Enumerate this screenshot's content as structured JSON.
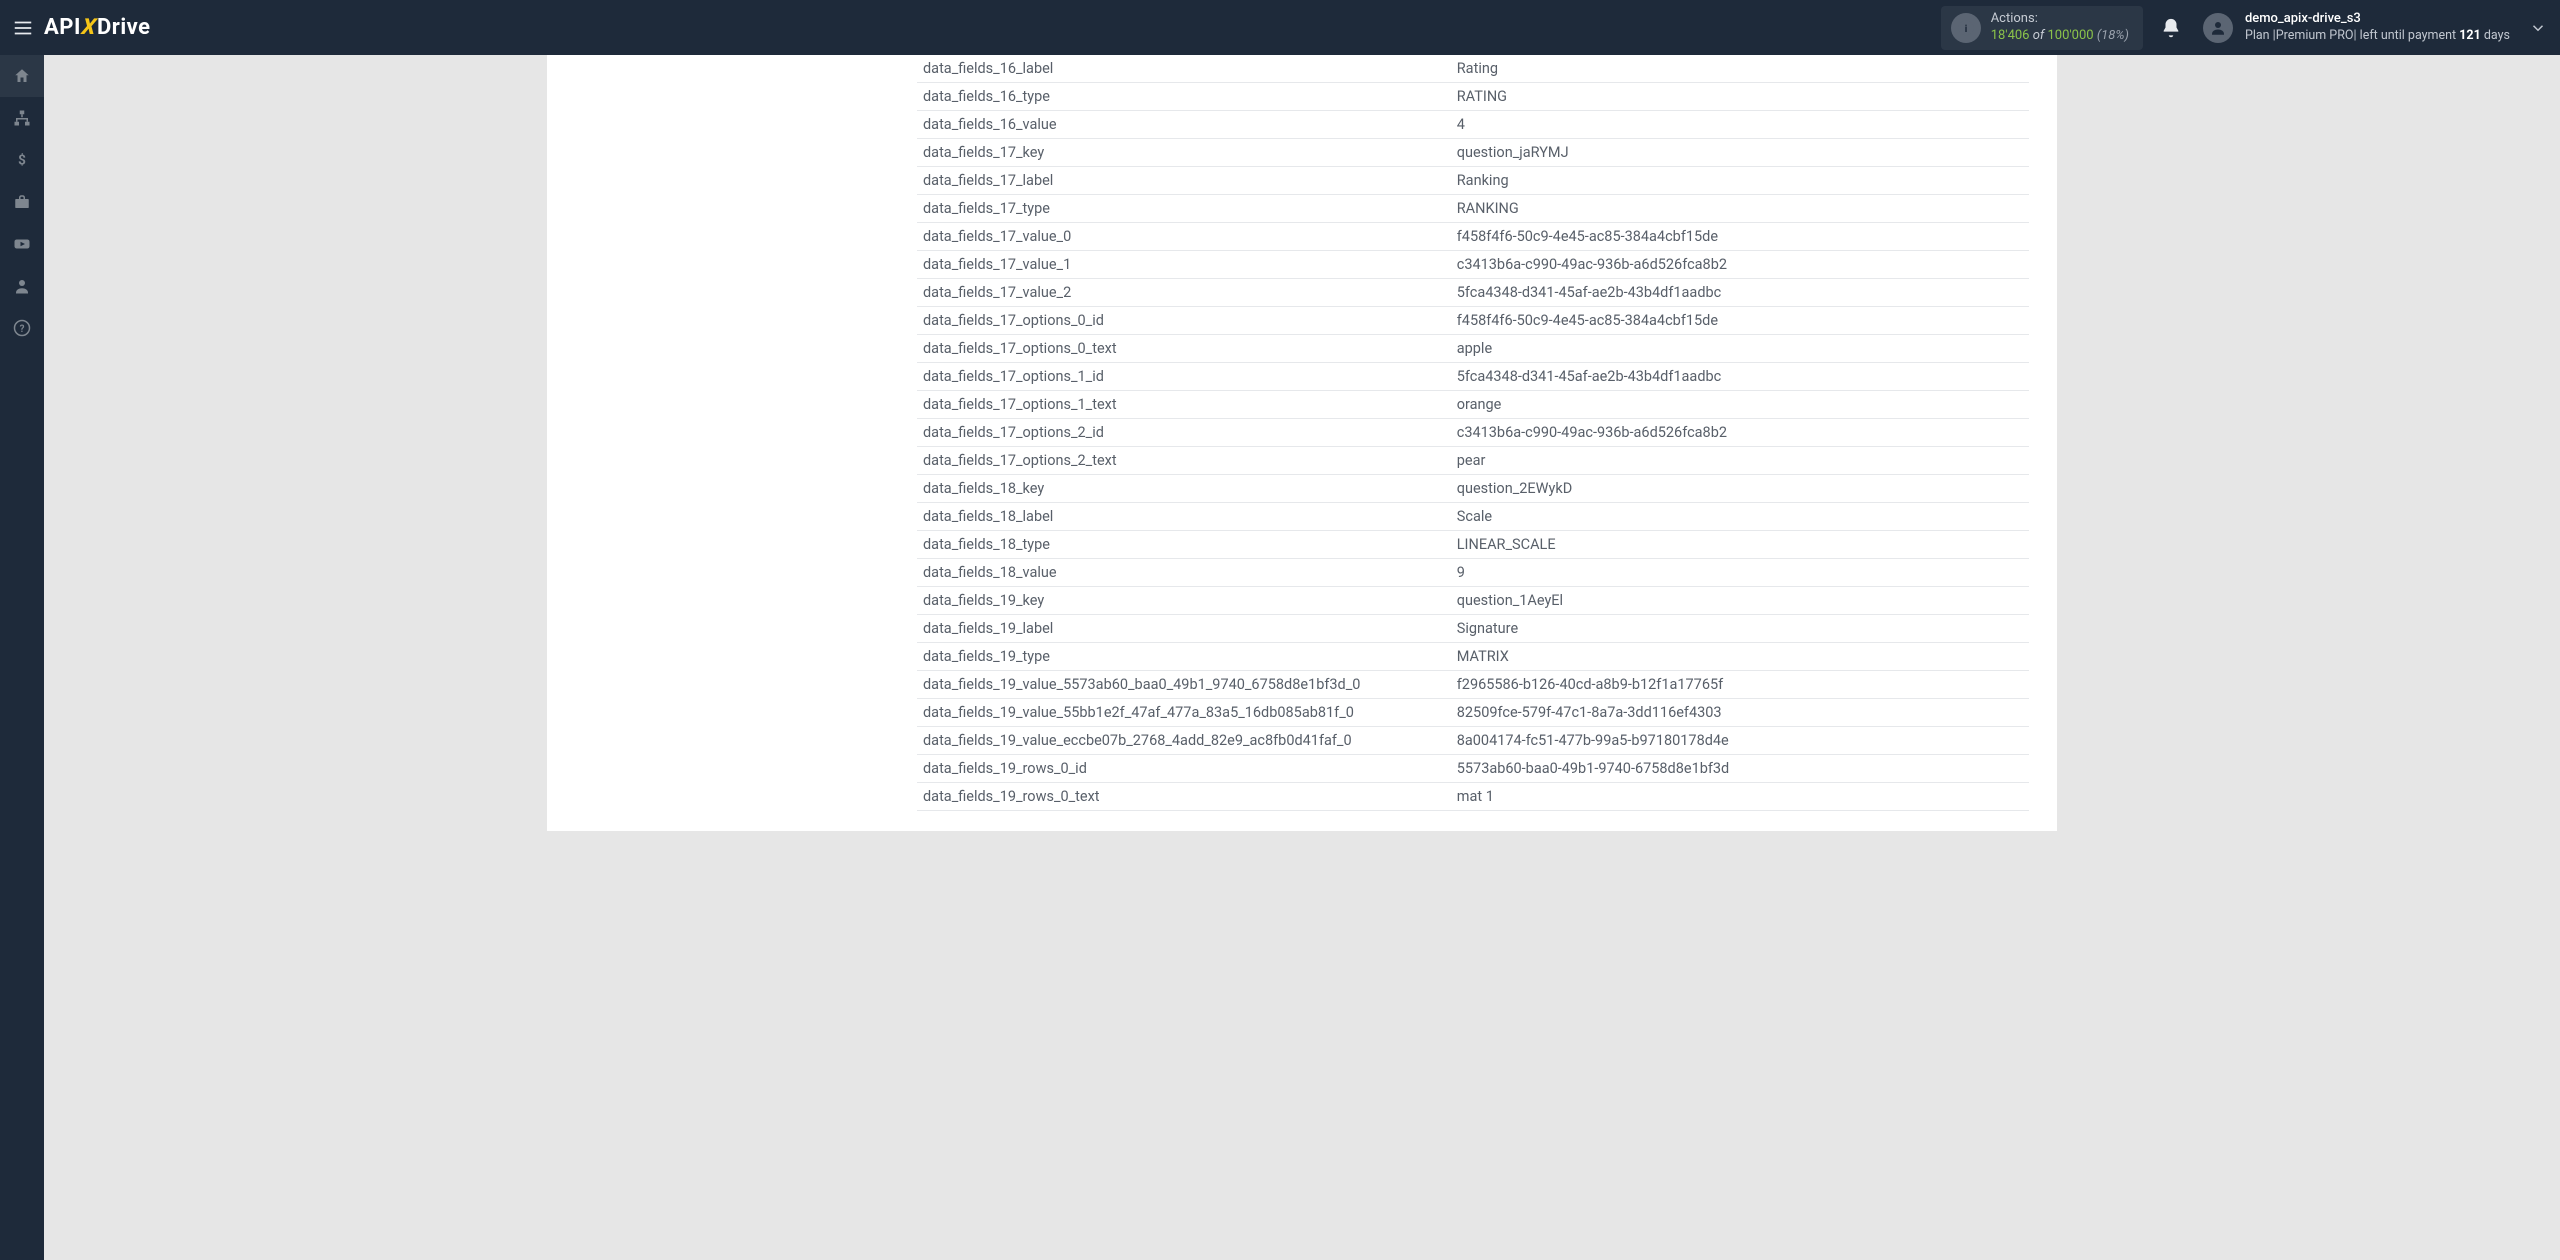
{
  "header": {
    "actions_label": "Actions:",
    "actions_current": "18'406",
    "actions_of": " of ",
    "actions_max": "100'000",
    "actions_pct": "(18%)",
    "username": "demo_apix-drive_s3",
    "plan_prefix": "Plan |",
    "plan_name": "Premium PRO",
    "plan_mid": "| left until payment ",
    "plan_days_num": "121",
    "plan_days_suffix": " days"
  },
  "logo": {
    "pre": "API",
    "x": "X",
    "post": "Drive"
  },
  "rows": [
    {
      "k": "data_fields_16_label",
      "v": "Rating"
    },
    {
      "k": "data_fields_16_type",
      "v": "RATING"
    },
    {
      "k": "data_fields_16_value",
      "v": "4"
    },
    {
      "k": "data_fields_17_key",
      "v": "question_jaRYMJ"
    },
    {
      "k": "data_fields_17_label",
      "v": "Ranking"
    },
    {
      "k": "data_fields_17_type",
      "v": "RANKING"
    },
    {
      "k": "data_fields_17_value_0",
      "v": "f458f4f6-50c9-4e45-ac85-384a4cbf15de"
    },
    {
      "k": "data_fields_17_value_1",
      "v": "c3413b6a-c990-49ac-936b-a6d526fca8b2"
    },
    {
      "k": "data_fields_17_value_2",
      "v": "5fca4348-d341-45af-ae2b-43b4df1aadbc"
    },
    {
      "k": "data_fields_17_options_0_id",
      "v": "f458f4f6-50c9-4e45-ac85-384a4cbf15de"
    },
    {
      "k": "data_fields_17_options_0_text",
      "v": "apple"
    },
    {
      "k": "data_fields_17_options_1_id",
      "v": "5fca4348-d341-45af-ae2b-43b4df1aadbc"
    },
    {
      "k": "data_fields_17_options_1_text",
      "v": "orange"
    },
    {
      "k": "data_fields_17_options_2_id",
      "v": "c3413b6a-c990-49ac-936b-a6d526fca8b2"
    },
    {
      "k": "data_fields_17_options_2_text",
      "v": "pear"
    },
    {
      "k": "data_fields_18_key",
      "v": "question_2EWykD"
    },
    {
      "k": "data_fields_18_label",
      "v": "Scale"
    },
    {
      "k": "data_fields_18_type",
      "v": "LINEAR_SCALE"
    },
    {
      "k": "data_fields_18_value",
      "v": "9"
    },
    {
      "k": "data_fields_19_key",
      "v": "question_1AeyEl"
    },
    {
      "k": "data_fields_19_label",
      "v": "Signature"
    },
    {
      "k": "data_fields_19_type",
      "v": "MATRIX"
    },
    {
      "k": "data_fields_19_value_5573ab60_baa0_49b1_9740_6758d8e1bf3d_0",
      "v": "f2965586-b126-40cd-a8b9-b12f1a17765f"
    },
    {
      "k": "data_fields_19_value_55bb1e2f_47af_477a_83a5_16db085ab81f_0",
      "v": "82509fce-579f-47c1-8a7a-3dd116ef4303"
    },
    {
      "k": "data_fields_19_value_eccbe07b_2768_4add_82e9_ac8fb0d41faf_0",
      "v": "8a004174-fc51-477b-99a5-b97180178d4e"
    },
    {
      "k": "data_fields_19_rows_0_id",
      "v": "5573ab60-baa0-49b1-9740-6758d8e1bf3d"
    },
    {
      "k": "data_fields_19_rows_0_text",
      "v": "mat 1"
    }
  ]
}
